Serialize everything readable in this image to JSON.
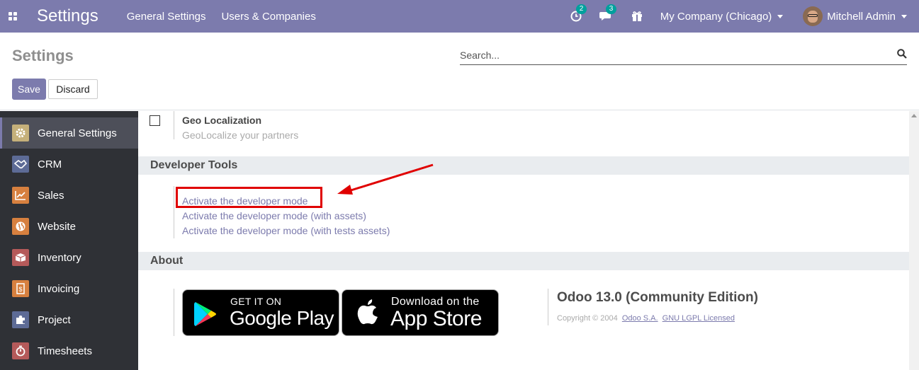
{
  "navbar": {
    "app_title": "Settings",
    "menu": [
      "General Settings",
      "Users & Companies"
    ],
    "activity_count": "2",
    "messages_count": "3",
    "company": "My Company (Chicago)",
    "user": "Mitchell Admin",
    "color": "#7c7bad"
  },
  "control_panel": {
    "breadcrumb": "Settings",
    "search_placeholder": "Search...",
    "save_label": "Save",
    "discard_label": "Discard"
  },
  "sidebar": {
    "items": [
      {
        "label": "General Settings",
        "icon": "gear-icon",
        "color": "#c5b07a",
        "active": true
      },
      {
        "label": "CRM",
        "icon": "handshake-icon",
        "color": "#5d6b96"
      },
      {
        "label": "Sales",
        "icon": "chart-icon",
        "color": "#d7803f"
      },
      {
        "label": "Website",
        "icon": "globe-icon",
        "color": "#d7803f"
      },
      {
        "label": "Inventory",
        "icon": "box-icon",
        "color": "#b55a5a"
      },
      {
        "label": "Invoicing",
        "icon": "invoice-icon",
        "color": "#d7803f"
      },
      {
        "label": "Project",
        "icon": "puzzle-icon",
        "color": "#5d6b96"
      },
      {
        "label": "Timesheets",
        "icon": "stopwatch-icon",
        "color": "#b55a5a"
      }
    ]
  },
  "content": {
    "geo": {
      "title": "Geo Localization",
      "description": "GeoLocalize your partners"
    },
    "developer_tools": {
      "heading": "Developer Tools",
      "links": [
        "Activate the developer mode",
        "Activate the developer mode (with assets)",
        "Activate the developer mode (with tests assets)"
      ]
    },
    "about": {
      "heading": "About",
      "google_play_small": "GET IT ON",
      "google_play_big": "Google Play",
      "app_store_small": "Download on the",
      "app_store_big": "App Store",
      "edition": "Odoo 13.0 (Community Edition)",
      "copyright": "Copyright © 2004",
      "company_link": "Odoo S.A.",
      "license_link": "GNU LGPL Licensed"
    }
  },
  "annotation": {
    "color": "#e00000"
  }
}
